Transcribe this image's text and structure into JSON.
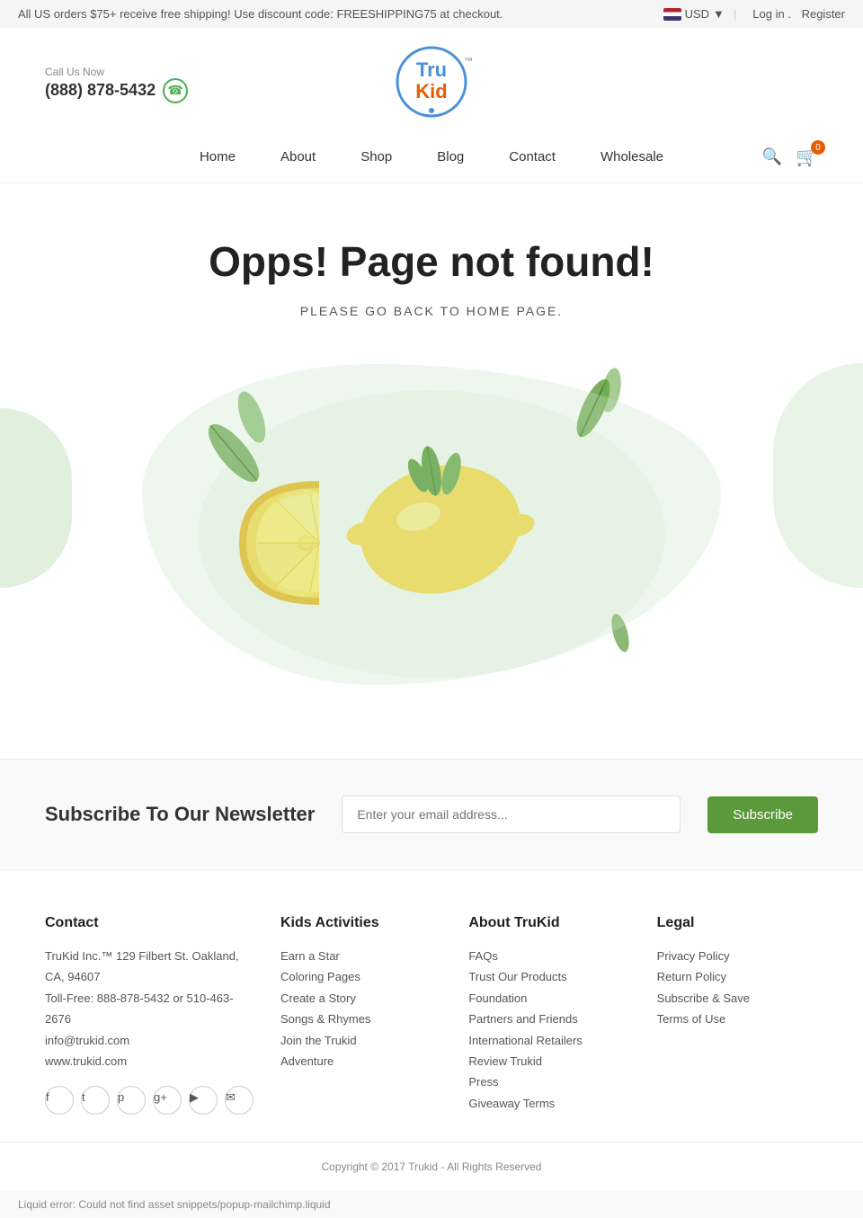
{
  "topbar": {
    "promo_text": "All US orders $75+ receive free shipping! Use discount code: FREESHIPPING75 at checkout.",
    "currency": "USD",
    "login_label": "Log in",
    "register_label": "Register"
  },
  "header": {
    "call_label": "Call Us Now",
    "phone": "(888) 878-5432",
    "logo_tru": "Tru",
    "logo_kid": "Kid",
    "logo_tm": "™",
    "logo_dot": "●"
  },
  "nav": {
    "items": [
      {
        "label": "Home",
        "href": "#"
      },
      {
        "label": "About",
        "href": "#"
      },
      {
        "label": "Shop",
        "href": "#"
      },
      {
        "label": "Blog",
        "href": "#"
      },
      {
        "label": "Contact",
        "href": "#"
      },
      {
        "label": "Wholesale",
        "href": "#"
      }
    ],
    "cart_count": "0"
  },
  "not_found": {
    "title": "Opps! Page not found!",
    "subtitle": "PLEASE GO BACK TO HOME PAGE."
  },
  "newsletter": {
    "title": "Subscribe To Our Newsletter",
    "input_placeholder": "Enter your email address...",
    "button_label": "Subscribe"
  },
  "footer": {
    "contact": {
      "heading": "Contact",
      "address": "TruKid Inc.™ 129 Filbert St. Oakland, CA, 94607",
      "tollfree": "Toll-Free: 888-878-5432 or 510-463-2676",
      "email": "info@trukid.com",
      "website": "www.trukid.com"
    },
    "kids_activities": {
      "heading": "Kids Activities",
      "links": [
        "Earn a Star",
        "Coloring Pages",
        "Create a Story",
        "Songs & Rhymes",
        "Join the Trukid",
        "Adventure"
      ]
    },
    "about": {
      "heading": "About TruKid",
      "links": [
        "FAQs",
        "Trust Our Products",
        "Foundation",
        "Partners and Friends",
        "International Retailers",
        "Review Trukid",
        "Press",
        "Giveaway Terms"
      ]
    },
    "legal": {
      "heading": "Legal",
      "links": [
        "Privacy Policy",
        "Return Policy",
        "Subscribe & Save",
        "Terms of Use"
      ]
    },
    "social": [
      {
        "name": "facebook",
        "icon": "f"
      },
      {
        "name": "twitter",
        "icon": "t"
      },
      {
        "name": "pinterest",
        "icon": "p"
      },
      {
        "name": "google-plus",
        "icon": "g+"
      },
      {
        "name": "youtube",
        "icon": "▶"
      },
      {
        "name": "instagram",
        "icon": "✉"
      }
    ]
  },
  "copyright": {
    "text": "Copyright © 2017 Trukid - All Rights Reserved"
  },
  "liquid_error": {
    "text": "Liquid error: Could not find asset snippets/popup-mailchimp.liquid"
  }
}
